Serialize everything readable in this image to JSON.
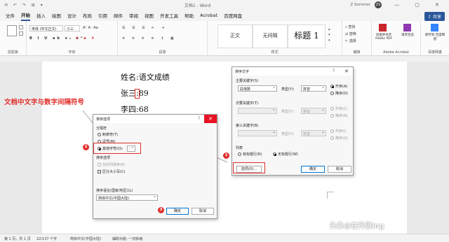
{
  "window": {
    "quick_access": "⟲ ↶ ↷ ⊞ ▾",
    "title": "文档1 - Word",
    "user": "Z Sommer",
    "avatar_initials": "ZS",
    "controls": "— ▢ ✕"
  },
  "menu": {
    "tabs": [
      "文件",
      "开始",
      "插入",
      "绘图",
      "设计",
      "布局",
      "引用",
      "邮件",
      "审阅",
      "视图",
      "开发工具",
      "帮助",
      "Acrobat",
      "百度网盘"
    ],
    "active_index": 1,
    "share_label": "共享"
  },
  "ribbon": {
    "clipboard_label": "剪贴板",
    "font_label": "字体",
    "paragraph_label": "段落",
    "styles_label": "样式",
    "editing_label": "编辑",
    "acrobat_label": "Adobe Acrobat",
    "baidu_label": "百度网盘",
    "font_name": "宋体 (中文正文)",
    "font_size": "小三",
    "style_normal": "正文",
    "style_nospace": "无间隔",
    "style_heading1": "标题 1",
    "find": "查找",
    "replace": "替换",
    "select": "选择",
    "create_pdf": "创建并共享 Adobe PDF",
    "request_sign": "请求签名",
    "save_baidu": "保存到 百度网盘"
  },
  "document": {
    "lines": [
      "姓名:语文成绩",
      "张三:89",
      "李四:68"
    ]
  },
  "annotations": {
    "callout_text": "文档中文字与数字间隔符号",
    "badge_1": "1",
    "badge_2": "2",
    "badge_3": "3",
    "watermark": "头条@在升级ing"
  },
  "sort_dialog": {
    "title": "排序文字",
    "help": "?",
    "close": "✕",
    "primary_label": "主要关键字(S)",
    "primary_value": "段落数",
    "type_label": "类型(Y):",
    "type_value": "拼音",
    "asc_label": "升序(A)",
    "desc_label": "降序(D)",
    "secondary_label": "次要关键字(T)",
    "third_label": "第三关键字(B)",
    "asc_label2": "升序(C)",
    "desc_label2": "降序(N)",
    "asc_label3": "升序(I)",
    "desc_label3": "降序(G)",
    "list_label": "列表",
    "header_row": "有标题行(R)",
    "no_header_row": "无标题行(W)",
    "options_button": "选项(O)...",
    "ok": "确定",
    "cancel": "取消"
  },
  "options_dialog": {
    "title": "排序选项",
    "help": "?",
    "close": "✕",
    "separator_label": "分隔符",
    "tab_label": "制表符(T)",
    "comma_label": "逗号(M)",
    "other_label": "其他字符(O):",
    "other_value": ":",
    "sort_options_label": "排序选项",
    "column_only": "仅对列排序(R)",
    "case_sensitive": "区分大小写(C)",
    "language_label": "排序语言(国家/地区)(L)",
    "language_value": "简体中文(中国大陆)",
    "ok": "确定",
    "cancel": "取消"
  },
  "status": {
    "page": "第 1 页，共 1 页",
    "words": "22/137 个字",
    "lang": "简体中文(中国大陆)",
    "accessibility": "辅助功能: 一切就绪"
  }
}
